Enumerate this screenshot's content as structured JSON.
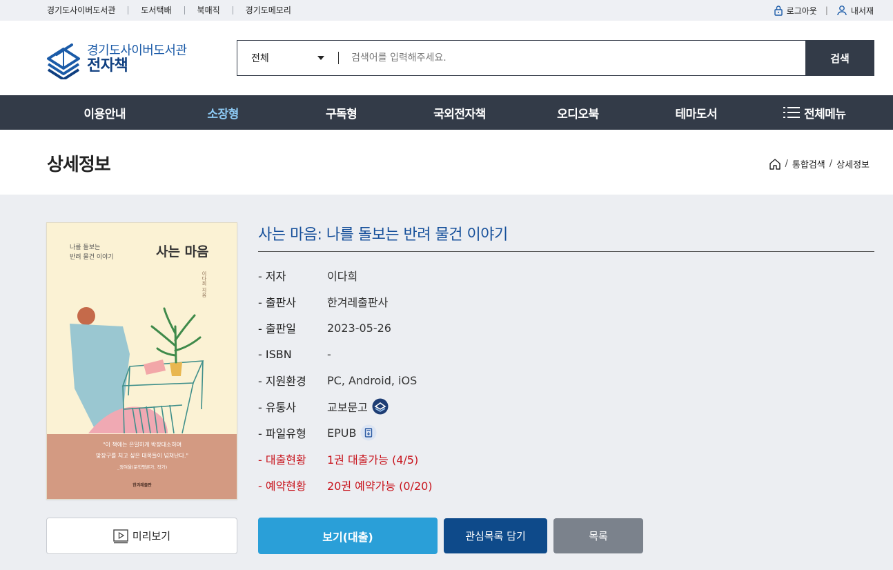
{
  "util": {
    "links": [
      "경기도사이버도서관",
      "도서택배",
      "북매직",
      "경기도메모리"
    ],
    "logout": "로그아웃",
    "mylib": "내서재"
  },
  "logo": {
    "line1": "경기도사이버도서관",
    "line2": "전자책"
  },
  "search": {
    "category": "전체",
    "placeholder": "검색어를 입력해주세요.",
    "button": "검색"
  },
  "nav": [
    "이용안내",
    "소장형",
    "구독형",
    "국외전자책",
    "오디오북",
    "테마도서",
    "전체메뉴"
  ],
  "page": {
    "title": "상세정보"
  },
  "breadcrumb": [
    "통합검색",
    "상세정보"
  ],
  "book": {
    "title": "사는 마음: 나를 돌보는 반려 물건 이야기",
    "cover": {
      "subtitle_line1": "나를 돌보는",
      "subtitle_line2": "반려 물건 이야기",
      "title": "사는 마음",
      "author": "이다희 지음",
      "quote_line1": "\"이 책에는 은밀하게 박장대소하며",
      "quote_line2": "맞장구를 치고 싶은 대목들이 넘쳐난다.\"",
      "quote_source": "_정여울(문학평론가, 작가)",
      "publisher": "한겨레출판"
    },
    "fields": [
      {
        "label": "- 저자",
        "value": "이다희"
      },
      {
        "label": "- 출판사",
        "value": "한겨레출판사"
      },
      {
        "label": "- 출판일",
        "value": "2023-05-26"
      },
      {
        "label": "- ISBN",
        "value": "-"
      },
      {
        "label": "- 지원환경",
        "value": "PC, Android, iOS"
      },
      {
        "label": "- 유통사",
        "value": "교보문고"
      },
      {
        "label": "- 파일유형",
        "value": "EPUB"
      },
      {
        "label": "- 대출현황",
        "value": "1권 대출가능 (4/5)"
      },
      {
        "label": "- 예약현황",
        "value": "20권 예약가능 (0/20)"
      }
    ]
  },
  "buttons": {
    "preview": "미리보기",
    "view": "보기(대출)",
    "wishlist": "관심목록 담기",
    "list": "목록"
  },
  "colors": {
    "nav_bg": "#333b48",
    "accent_blue": "#154f9a",
    "status_red": "#c8141d",
    "view_btn": "#2a9fd8"
  }
}
